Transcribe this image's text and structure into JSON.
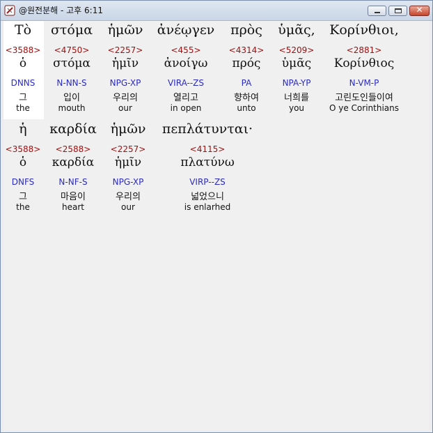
{
  "window": {
    "title": "@원전분해 - 고후 6:11",
    "controls": {
      "minimize": "minimize-icon",
      "maximize": "maximize-icon",
      "close": "close-icon"
    }
  },
  "lines": [
    {
      "words": [
        {
          "greek": "Τὸ",
          "strong": "<3588>",
          "lemma": "ὁ",
          "parse": "DNNS",
          "korean": "그",
          "gloss": "the"
        },
        {
          "greek": "στόμα",
          "strong": "<4750>",
          "lemma": "στόμα",
          "parse": "N-NN-S",
          "korean": "입이",
          "gloss": "mouth"
        },
        {
          "greek": "ἡμῶν",
          "strong": "<2257>",
          "lemma": "ἡμῖν",
          "parse": "NPG-XP",
          "korean": "우리의",
          "gloss": "our"
        },
        {
          "greek": "ἀνέῳγεν",
          "strong": "<455>",
          "lemma": "ἀνοίγω",
          "parse": "VIRA--ZS",
          "korean": "열리고",
          "gloss": "in open"
        },
        {
          "greek": "πρὸς",
          "strong": "<4314>",
          "lemma": "πρός",
          "parse": "PA",
          "korean": "향하여",
          "gloss": "unto"
        },
        {
          "greek": "ὑμᾶς,",
          "strong": "<5209>",
          "lemma": "ὑμᾶς",
          "parse": "NPA-YP",
          "korean": "너희를",
          "gloss": "you"
        },
        {
          "greek": "Κορίνθιοι,",
          "strong": "<2881>",
          "lemma": "Κορίνθιος",
          "parse": "N-VM-P",
          "korean": "고린도인들이여",
          "gloss": "O ye Corinthians"
        }
      ]
    },
    {
      "words": [
        {
          "greek": "ἡ",
          "strong": "<3588>",
          "lemma": "ὁ",
          "parse": "DNFS",
          "korean": "그",
          "gloss": "the"
        },
        {
          "greek": "καρδία",
          "strong": "<2588>",
          "lemma": "καρδία",
          "parse": "N-NF-S",
          "korean": "마음이",
          "gloss": "heart"
        },
        {
          "greek": "ἡμῶν",
          "strong": "<2257>",
          "lemma": "ἡμῖν",
          "parse": "NPG-XP",
          "korean": "우리의",
          "gloss": "our"
        },
        {
          "greek": "πεπλάτυνται·",
          "strong": "<4115>",
          "lemma": "πλατύνω",
          "parse": "VIRP--ZS",
          "korean": "넓었으니",
          "gloss": "is enlarhed"
        }
      ]
    }
  ]
}
